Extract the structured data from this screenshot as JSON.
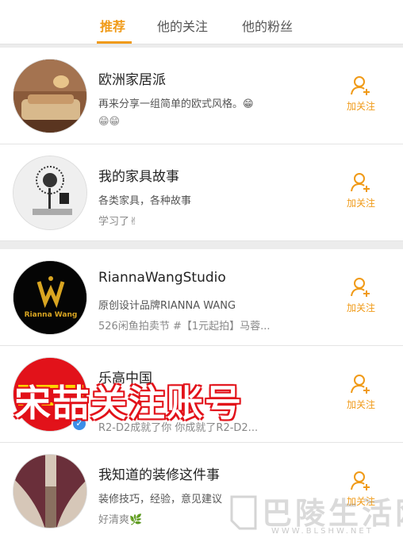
{
  "tabs": [
    {
      "label": "推荐",
      "active": true
    },
    {
      "label": "他的关注",
      "active": false
    },
    {
      "label": "他的粉丝",
      "active": false
    }
  ],
  "accent_color": "#f09a17",
  "follow_label": "加关注",
  "users": [
    {
      "name": "欧洲家居派",
      "desc": "再来分享一组简单的欧式风格。😁",
      "extra": "😁😁",
      "avatar_icon": "european-interior-avatar"
    },
    {
      "name": "我的家具故事",
      "desc": "各类家具，各种故事",
      "extra": "学习了✌",
      "avatar_icon": "tree-decal-avatar"
    },
    {
      "name": "RiannaWangStudio",
      "desc": "原创设计品牌RIANNA WANG",
      "extra": "526闲鱼拍卖节 #【1元起拍】马蓉...",
      "avatar_icon": "rianna-wang-logo-avatar",
      "avatar_text": "Rianna Wang"
    },
    {
      "name": "乐高中国",
      "desc": "",
      "extra": "R2-D2成就了你 你成就了R2-D2...",
      "avatar_icon": "lego-logo-avatar",
      "verified": true
    },
    {
      "name": "我知道的装修这件事",
      "desc": "装修技巧，经验，意见建议",
      "extra": "好清爽🌿",
      "avatar_icon": "curtain-room-avatar"
    }
  ],
  "overlay_text": "宋喆关注账号",
  "watermark": {
    "text": "巴陵生活网",
    "url": "WWW.BLSHW.NET"
  }
}
